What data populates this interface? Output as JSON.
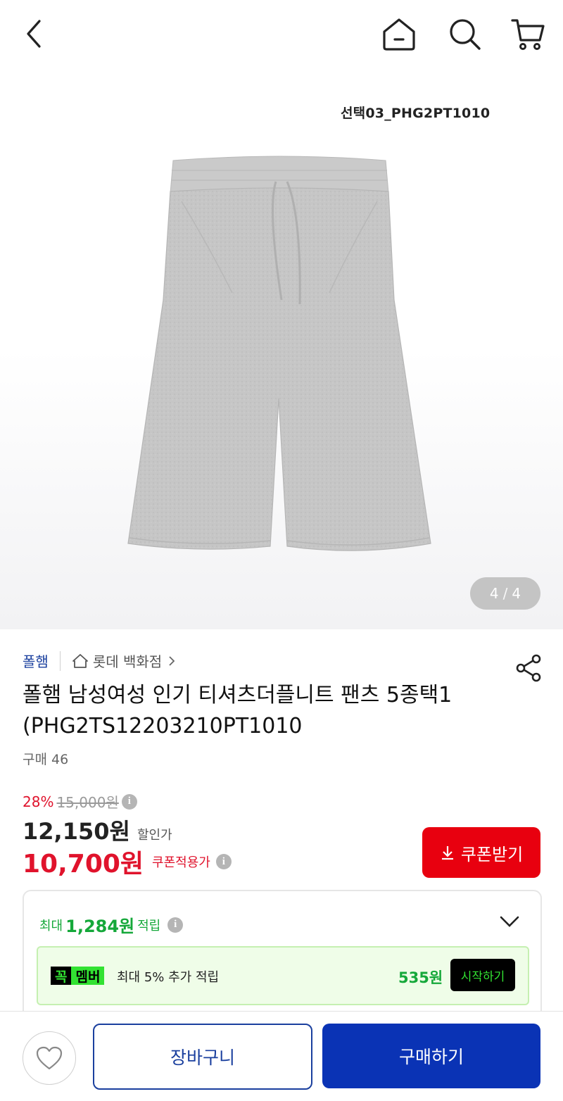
{
  "header": {
    "back_icon": "chevron-left-icon",
    "home_icon": "home-icon",
    "search_icon": "search-icon",
    "cart_icon": "cart-icon"
  },
  "gallery": {
    "image_caption": "선택03_PHG2PT1010",
    "image_subject": "gray jersey shorts",
    "current_page": "4",
    "page_separator": "/",
    "total_pages": "4"
  },
  "product": {
    "brand": "폴햄",
    "store": "롯데 백화점",
    "title": "폴햄 남성여성 인기 티셔츠더플니트 팬츠 5종택1 (PHG2TS12203210PT1010",
    "purchase_count": "구매 46"
  },
  "pricing": {
    "discount_rate": "28%",
    "original_price": "15,000원",
    "sale_price": "12,150원",
    "sale_label": "할인가",
    "coupon_price": "10,700원",
    "coupon_label": "쿠폰적용가",
    "coupon_button": "쿠폰받기",
    "info_glyph": "i",
    "accent_red": "#e0132c",
    "accent_green": "#15a83a"
  },
  "rewards": {
    "prefix": "최대",
    "amount": "1,284원",
    "suffix": "적립",
    "member_badge_a": "꼭",
    "member_badge_b": "멤버",
    "member_text": "최대 5% 추가 적립",
    "member_amount": "535원",
    "start_button": "시작하기"
  },
  "bottom_bar": {
    "wishlist_icon": "heart-icon",
    "cart_button": "장바구니",
    "buy_button": "구매하기",
    "brand_blue": "#0a33b5"
  }
}
